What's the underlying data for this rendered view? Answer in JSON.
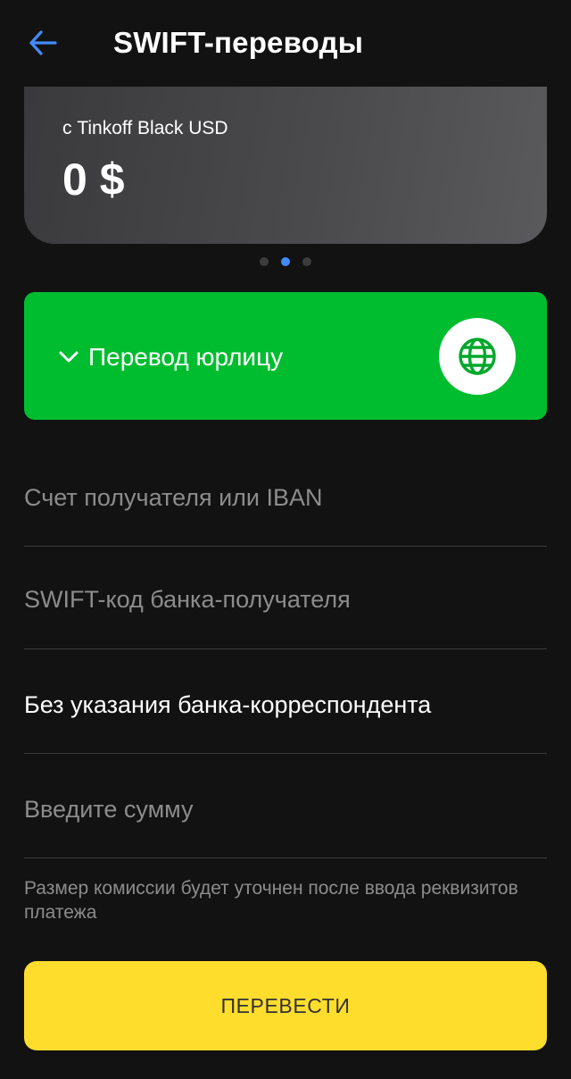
{
  "header": {
    "title": "SWIFT-переводы",
    "back_icon": "arrow-left-icon"
  },
  "account_card": {
    "label": "с Tinkoff Black USD",
    "balance": "0 $"
  },
  "pager": {
    "count": 3,
    "active_index": 1
  },
  "transfer_type": {
    "label": "Перевод юрлицу",
    "icon": "globe-icon"
  },
  "form": {
    "account_placeholder": "Счет получателя или IBAN",
    "swift_placeholder": "SWIFT-код банка-получателя",
    "correspondent_value": "Без указания банка-корреспондента",
    "amount_placeholder": "Введите сумму",
    "hint": "Размер комиссии будет уточнен после ввода реквизитов платежа"
  },
  "submit": {
    "label": "ПЕРЕВЕСТИ"
  },
  "colors": {
    "background": "#121212",
    "accent_blue": "#428bf9",
    "green": "#00bd2f",
    "yellow": "#ffdd2d"
  }
}
